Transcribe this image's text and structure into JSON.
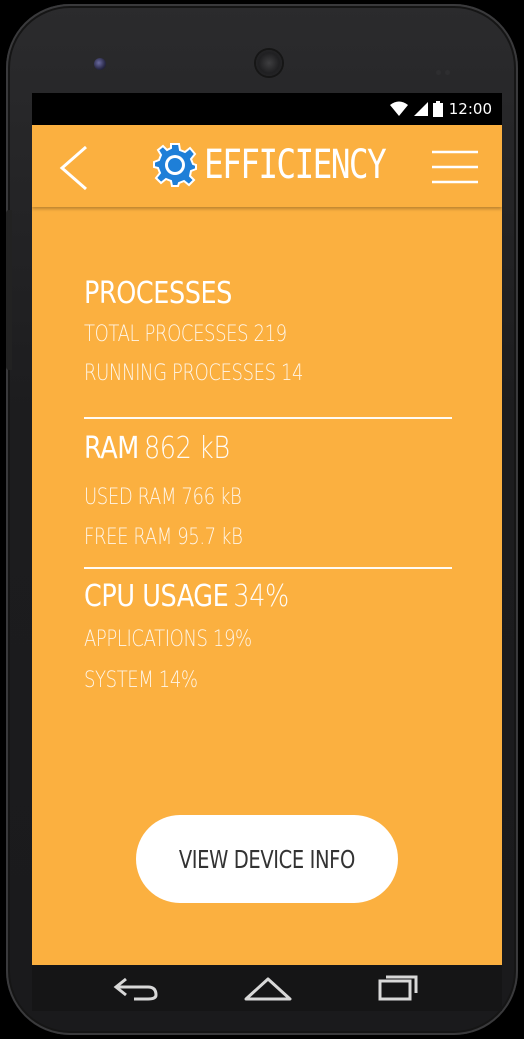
{
  "status_bar": {
    "time": "12:00"
  },
  "app_bar": {
    "title": "EFFICIENCY",
    "back_icon": "chevron-left-icon",
    "logo_icon": "gear-icon",
    "menu_icon": "hamburger-menu-icon"
  },
  "processes": {
    "heading": "PROCESSES",
    "total": "TOTAL PROCESSES 219",
    "running": "RUNNING PROCESSES 14"
  },
  "ram": {
    "heading": "RAM",
    "value": "862 kB",
    "used": "USED RAM 766 kB",
    "free": "FREE RAM 95.7 kB"
  },
  "cpu": {
    "heading": "CPU USAGE",
    "value": "34%",
    "applications": "APPLICATIONS 19%",
    "system": "SYSTEM 14%"
  },
  "actions": {
    "view_device_info": "VIEW DEVICE INFO"
  },
  "colors": {
    "accent": "#fbb040",
    "logo_blue": "#1e7fd8",
    "text": "#ffffff"
  }
}
